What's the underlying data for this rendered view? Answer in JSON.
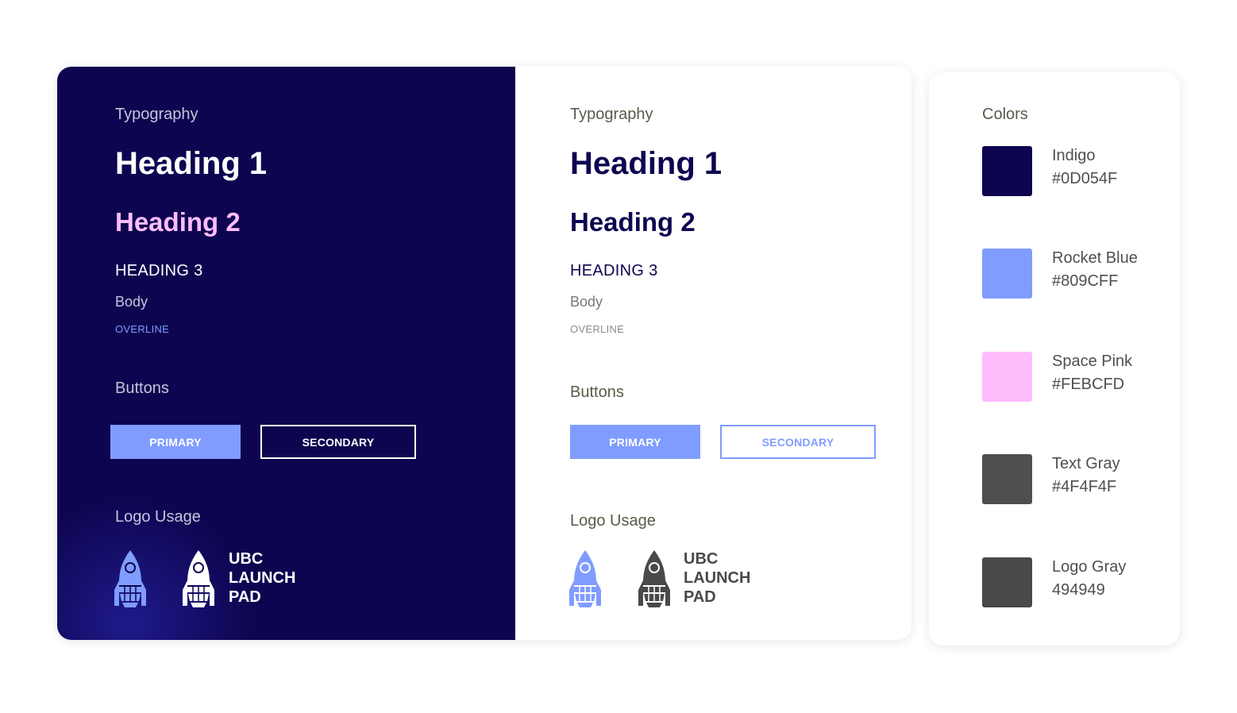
{
  "dark_panel": {
    "typography_title": "Typography",
    "heading1": "Heading 1",
    "heading2": "Heading 2",
    "heading3": "HEADING 3",
    "body": "Body",
    "overline": "OVERLINE",
    "buttons_title": "Buttons",
    "primary_label": "PRIMARY",
    "secondary_label": "SECONDARY",
    "logo_title": "Logo Usage",
    "wordmark": [
      "UBC",
      "LAUNCH",
      "PAD"
    ]
  },
  "light_panel": {
    "typography_title": "Typography",
    "heading1": "Heading 1",
    "heading2": "Heading 2",
    "heading3": "HEADING 3",
    "body": "Body",
    "overline": "OVERLINE",
    "buttons_title": "Buttons",
    "primary_label": "PRIMARY",
    "secondary_label": "SECONDARY",
    "logo_title": "Logo Usage",
    "wordmark": [
      "UBC",
      "LAUNCH",
      "PAD"
    ]
  },
  "colors": {
    "title": "Colors",
    "items": [
      {
        "name": "Indigo",
        "code": "#0D054F",
        "hex": "#0D054F"
      },
      {
        "name": "Rocket Blue",
        "code": "#809CFF",
        "hex": "#809CFF"
      },
      {
        "name": "Space Pink",
        "code": "#FEBCFD",
        "hex": "#FEBCFD"
      },
      {
        "name": "Text Gray",
        "code": "#4F4F4F",
        "hex": "#4F4F4F"
      },
      {
        "name": "Logo Gray",
        "code": "494949",
        "hex": "#494949"
      }
    ]
  },
  "icons": [
    "rocket-icon"
  ]
}
